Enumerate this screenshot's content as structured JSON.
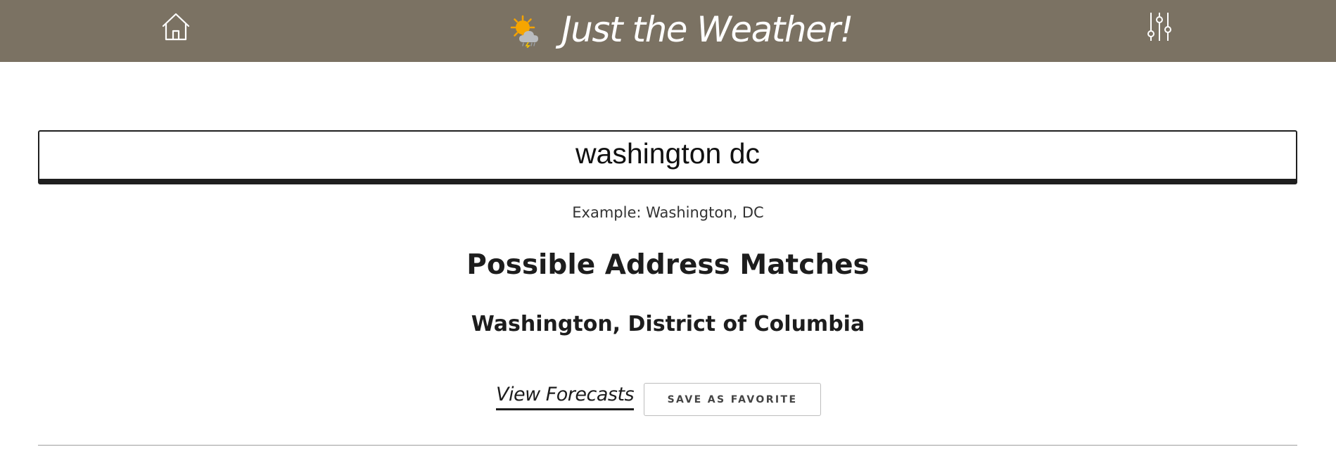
{
  "header": {
    "title": "Just the Weather!",
    "home_icon": "home-icon",
    "logo_icon": "sun-storm-cloud-icon",
    "settings_icon": "sliders-icon",
    "background_color": "#7b7263"
  },
  "search": {
    "value": "washington dc",
    "example": "Example: Washington, DC"
  },
  "results": {
    "heading": "Possible Address Matches",
    "matches": [
      {
        "name": "Washington, District of Columbia",
        "view_label": "View Forecasts",
        "save_label": "SAVE AS FAVORITE"
      }
    ]
  }
}
